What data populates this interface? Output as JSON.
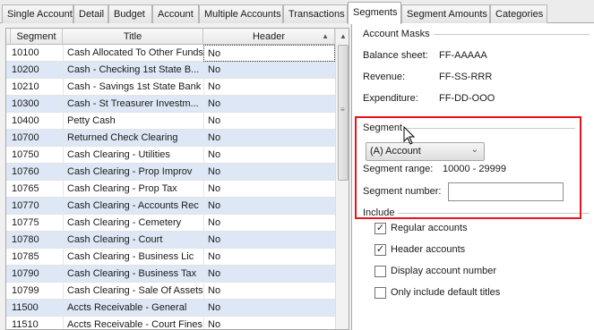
{
  "tabs": [
    {
      "label": "Single Account",
      "active": false
    },
    {
      "label": "Detail",
      "active": false
    },
    {
      "label": "Budget",
      "active": false
    },
    {
      "label": "Account",
      "active": false
    },
    {
      "label": "Multiple Accounts",
      "active": false
    },
    {
      "label": "Transactions",
      "active": false
    },
    {
      "label": "Segments",
      "active": true
    },
    {
      "label": "Segment Amounts",
      "active": false
    },
    {
      "label": "Categories",
      "active": false
    }
  ],
  "grid": {
    "columns": [
      "Segment",
      "Title",
      "Header"
    ],
    "rows": [
      {
        "segment": "10100",
        "title": "Cash Allocated To Other Funds",
        "header": "No"
      },
      {
        "segment": "10200",
        "title": "Cash - Checking 1st State B...",
        "header": "No"
      },
      {
        "segment": "10210",
        "title": "Cash - Savings 1st State Bank",
        "header": "No"
      },
      {
        "segment": "10300",
        "title": "Cash - St Treasurer Investm...",
        "header": "No"
      },
      {
        "segment": "10400",
        "title": "Petty Cash",
        "header": "No"
      },
      {
        "segment": "10700",
        "title": "Returned Check Clearing",
        "header": "No"
      },
      {
        "segment": "10750",
        "title": "Cash Clearing - Utilities",
        "header": "No"
      },
      {
        "segment": "10760",
        "title": "Cash Clearing - Prop Improv",
        "header": "No"
      },
      {
        "segment": "10765",
        "title": "Cash Clearing - Prop Tax",
        "header": "No"
      },
      {
        "segment": "10770",
        "title": "Cash Clearing - Accounts Rec",
        "header": "No"
      },
      {
        "segment": "10775",
        "title": "Cash Clearing - Cemetery",
        "header": "No"
      },
      {
        "segment": "10780",
        "title": "Cash Clearing - Court",
        "header": "No"
      },
      {
        "segment": "10785",
        "title": "Cash Clearing - Business Lic",
        "header": "No"
      },
      {
        "segment": "10790",
        "title": "Cash Clearing - Business Tax",
        "header": "No"
      },
      {
        "segment": "10799",
        "title": "Cash Clearing - Sale Of Assets",
        "header": "No"
      },
      {
        "segment": "11500",
        "title": "Accts Receivable - General",
        "header": "No"
      },
      {
        "segment": "11510",
        "title": "Accts Receivable - Court Fines",
        "header": "No"
      }
    ]
  },
  "account_masks": {
    "title": "Account Masks",
    "balance_sheet_label": "Balance sheet:",
    "balance_sheet_value": "FF-AAAAA",
    "revenue_label": "Revenue:",
    "revenue_value": "FF-SS-RRR",
    "expenditure_label": "Expenditure:",
    "expenditure_value": "FF-DD-OOO"
  },
  "segment": {
    "title": "Segment",
    "selected": "(A) Account",
    "range_label": "Segment range:",
    "range_value": "10000 - 29999",
    "number_label": "Segment number:",
    "number_value": ""
  },
  "include": {
    "title": "Include",
    "options": [
      {
        "label": "Regular accounts",
        "checked": true
      },
      {
        "label": "Header accounts",
        "checked": true
      },
      {
        "label": "Display account number",
        "checked": false
      },
      {
        "label": "Only include default titles",
        "checked": false
      }
    ]
  },
  "colors": {
    "highlight": "#e8131c",
    "alt_row": "#dde7f5"
  }
}
